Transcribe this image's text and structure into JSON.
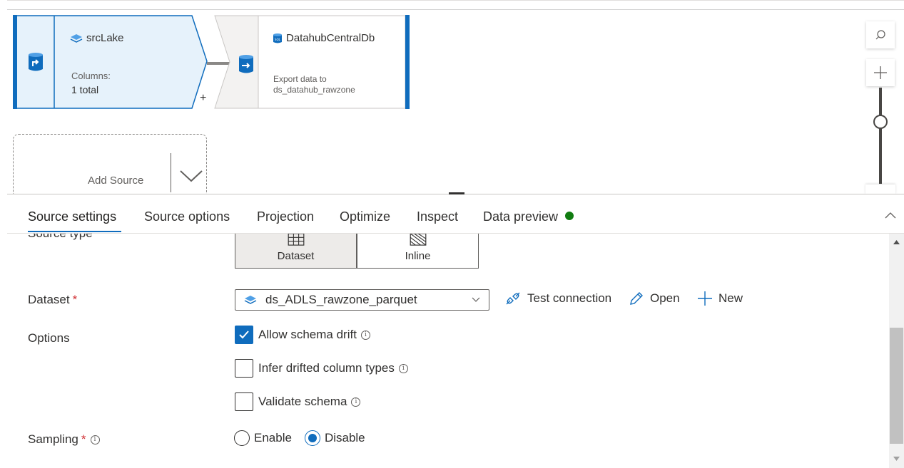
{
  "canvas": {
    "source_node": {
      "title": "srcLake",
      "columns_label": "Columns:",
      "columns_value": "1 total",
      "icon": "lake-icon",
      "action_icon": "source-arrow-icon",
      "plus": "+"
    },
    "sink_node": {
      "title": "DatahubCentralDb",
      "description_line1": "Export data to",
      "description_line2": "ds_datahub_rawzone",
      "icon": "sql-db-icon",
      "action_icon": "sink-arrow-icon"
    },
    "add_source": {
      "label": "Add Source"
    },
    "zoom": {
      "search_icon": "search-icon",
      "zoom_in_icon": "plus-icon"
    }
  },
  "tabs": [
    {
      "label": "Source settings",
      "active": true
    },
    {
      "label": "Source options"
    },
    {
      "label": "Projection"
    },
    {
      "label": "Optimize"
    },
    {
      "label": "Inspect"
    },
    {
      "label": "Data preview"
    }
  ],
  "status_color": "#107c10",
  "accent_color": "#0f6cbd",
  "form": {
    "source_type_label": "Source type",
    "source_type_options": [
      {
        "label": "Dataset",
        "icon": "table-icon",
        "selected": true
      },
      {
        "label": "Inline",
        "icon": "inline-icon"
      }
    ],
    "dataset": {
      "label": "Dataset",
      "required": "*",
      "selected": "ds_ADLS_rawzone_parquet",
      "actions": [
        {
          "label": "Test connection",
          "icon": "plug-icon"
        },
        {
          "label": "Open",
          "icon": "pencil-icon"
        },
        {
          "label": "New",
          "icon": "plus-icon"
        }
      ]
    },
    "options": {
      "label": "Options",
      "checkboxes": [
        {
          "label": "Allow schema drift",
          "checked": true
        },
        {
          "label": "Infer drifted column types",
          "checked": false
        },
        {
          "label": "Validate schema",
          "checked": false
        }
      ]
    },
    "sampling": {
      "label": "Sampling",
      "required": "*",
      "options": [
        {
          "label": "Enable",
          "selected": false
        },
        {
          "label": "Disable",
          "selected": true
        }
      ]
    }
  }
}
